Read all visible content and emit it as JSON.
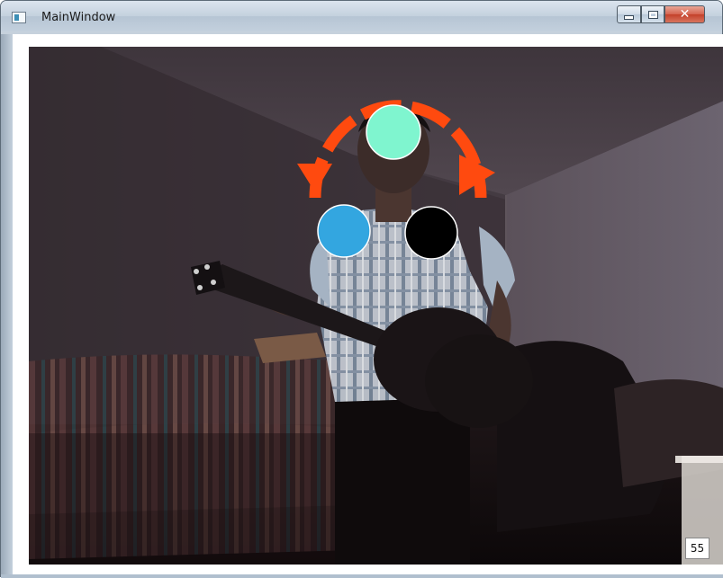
{
  "window": {
    "title": "MainWindow",
    "icons": {
      "app": "app-window-icon",
      "minimize": "minimize-icon",
      "maximize": "maximize-icon",
      "close": "close-icon"
    },
    "close_glyph": "✕"
  },
  "video": {
    "frame_counter": "55"
  },
  "overlay": {
    "colors": {
      "arrow": "#ff4a0f",
      "head_marker": "#7ff5cf",
      "left_hand_marker": "#33a6e0",
      "right_hand_marker": "#000000"
    },
    "icons": {
      "arrow": "curved-arrow-icon",
      "head_marker": "head-marker",
      "left_marker": "left-hand-marker",
      "right_marker": "right-hand-marker"
    }
  }
}
